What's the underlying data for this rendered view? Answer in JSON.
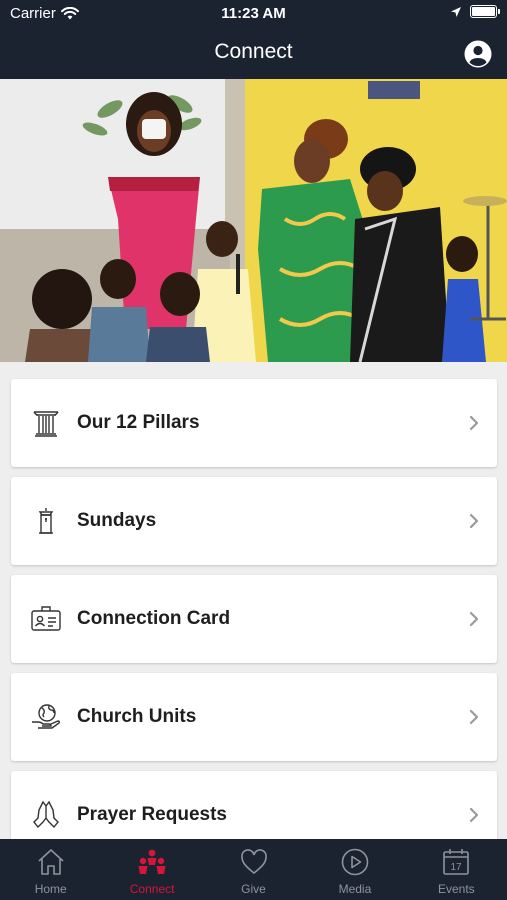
{
  "status_bar": {
    "carrier": "Carrier",
    "time": "11:23 AM"
  },
  "header": {
    "title": "Connect"
  },
  "menu": [
    {
      "label": "Our 12 Pillars",
      "icon": "pillar-icon"
    },
    {
      "label": "Sundays",
      "icon": "pulpit-icon"
    },
    {
      "label": "Connection Card",
      "icon": "id-card-icon"
    },
    {
      "label": "Church Units",
      "icon": "globe-hand-icon"
    },
    {
      "label": "Prayer Requests",
      "icon": "praying-hands-icon"
    }
  ],
  "tabs": [
    {
      "label": "Home",
      "icon": "home-icon",
      "active": false
    },
    {
      "label": "Connect",
      "icon": "people-icon",
      "active": true
    },
    {
      "label": "Give",
      "icon": "heart-icon",
      "active": false
    },
    {
      "label": "Media",
      "icon": "play-icon",
      "active": false
    },
    {
      "label": "Events",
      "icon": "calendar-icon",
      "active": false
    }
  ],
  "colors": {
    "bar": "#1b2330",
    "accent": "#d3163a",
    "inactive": "#8e949c",
    "background": "#eeeeee"
  }
}
